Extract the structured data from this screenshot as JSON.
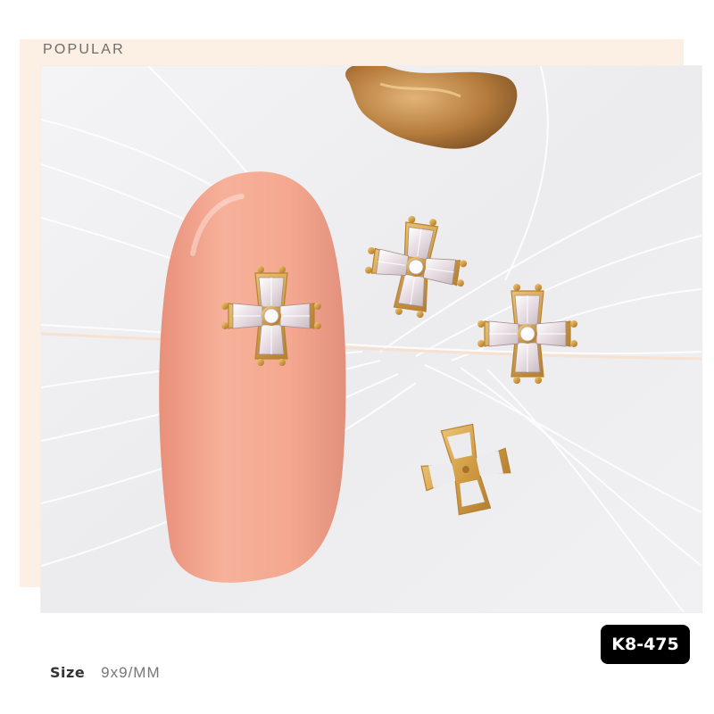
{
  "header": {
    "section_title": "POPULAR"
  },
  "product": {
    "sku": "K8-475",
    "size_label": "Size",
    "size_value": "9x9/MM"
  },
  "colors": {
    "band": "#fcefe4",
    "nail": "#f3a68e",
    "gold": "#d8aa52",
    "badge": "#000000"
  },
  "photo": {
    "subject": "gold cross nail charms with clear rhinestones on white feather background"
  }
}
